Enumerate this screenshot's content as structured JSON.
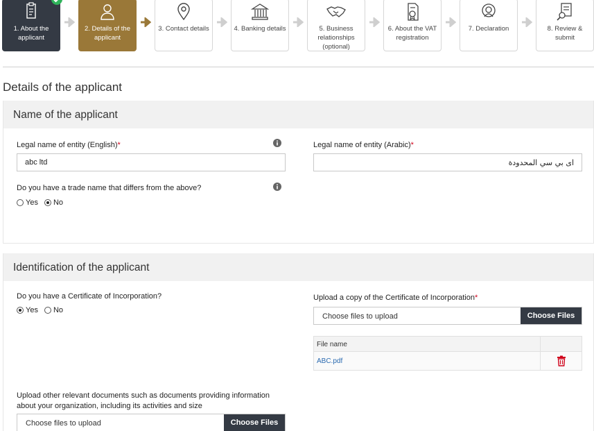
{
  "stepper": {
    "steps": [
      {
        "label": "1. About the applicant",
        "state": "done",
        "icon": "form-icon"
      },
      {
        "label": "2. Details of the applicant",
        "state": "active",
        "icon": "person-icon"
      },
      {
        "label": "3. Contact details",
        "state": "pending",
        "icon": "location-pin-icon"
      },
      {
        "label": "4. Banking details",
        "state": "pending",
        "icon": "bank-icon"
      },
      {
        "label": "5. Business relationships (optional)",
        "state": "pending",
        "icon": "handshake-icon"
      },
      {
        "label": "6. About the VAT registration",
        "state": "pending",
        "icon": "document-badge-icon"
      },
      {
        "label": "7. Declaration",
        "state": "pending",
        "icon": "headset-icon"
      },
      {
        "label": "8. Review & submit",
        "state": "pending",
        "icon": "review-icon"
      }
    ]
  },
  "page": {
    "title": "Details of the applicant"
  },
  "name_section": {
    "title": "Name of the applicant",
    "legal_name_en_label": "Legal name of entity (English)",
    "legal_name_en_value": "abc ltd",
    "legal_name_ar_label": "Legal name of entity (Arabic)",
    "legal_name_ar_value": "اى بي سي المحدودة",
    "trade_name_question": "Do you have a trade name that differs from the above?",
    "yes_label": "Yes",
    "no_label": "No",
    "trade_name_selected": "No"
  },
  "identification_section": {
    "title": "Identification of the applicant",
    "coi_question": "Do you have a Certificate of Incorporation?",
    "yes_label": "Yes",
    "no_label": "No",
    "coi_selected": "Yes",
    "coi_upload_label": "Upload a copy of the Certificate of Incorporation",
    "upload_placeholder": "Choose files to upload",
    "choose_button": "Choose Files",
    "file_table_header": "File name",
    "files": [
      {
        "name": "ABC.pdf"
      }
    ],
    "other_docs_label_line1": "Upload other relevant documents such as documents providing information",
    "other_docs_label_line2": "about your organization, including its activities and size",
    "other_upload_placeholder": "Choose files to upload",
    "other_choose_button": "Choose Files"
  },
  "colors": {
    "done": "#343a44",
    "active": "#9a7838",
    "required": "#d0021b",
    "delete": "#d0021b",
    "link": "#2a6ab0"
  }
}
